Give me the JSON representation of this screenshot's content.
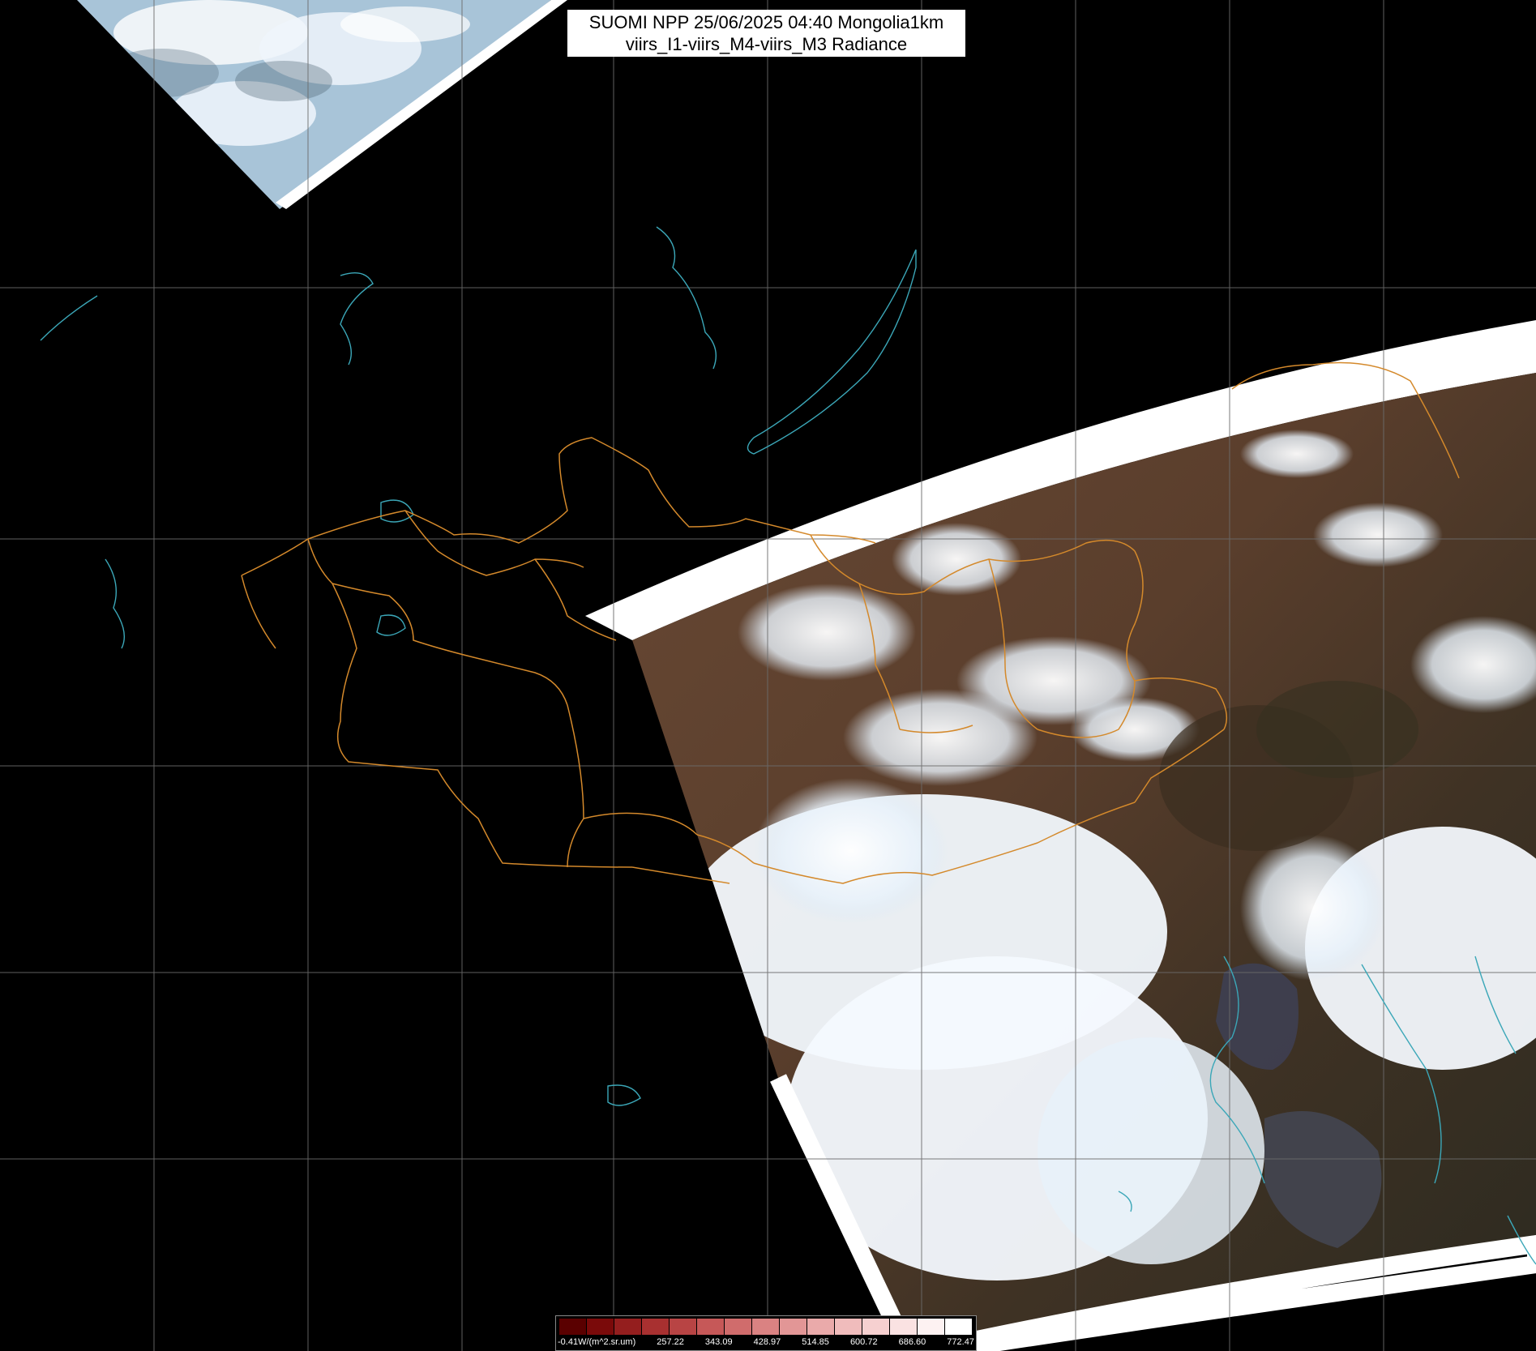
{
  "title": {
    "line1": "SUOMI NPP 25/06/2025 04:40 Mongolia1km",
    "line2": "viirs_I1-viirs_M4-viirs_M3 Radiance"
  },
  "colorbar": {
    "labels": [
      "-0.41W/(m^2.sr.um)",
      "257.22",
      "343.09",
      "428.97",
      "514.85",
      "600.72",
      "686.60",
      "772.47"
    ],
    "colors": [
      "#5a0000",
      "#7a0a0a",
      "#941e1e",
      "#a83030",
      "#b84444",
      "#c65858",
      "#d06c6c",
      "#da8282",
      "#e29696",
      "#eaaaaa",
      "#f0bcbc",
      "#f6d0d0",
      "#fae2e2",
      "#fdf2f2",
      "#ffffff"
    ]
  },
  "colors": {
    "background": "#000000",
    "grid": "#6b6b6b",
    "province_borders": "#d4892b",
    "coastlines": "#3ba7b8",
    "no_data_band": "#ffffff",
    "land": "#5b4030",
    "clouds": "#eef5fb"
  }
}
